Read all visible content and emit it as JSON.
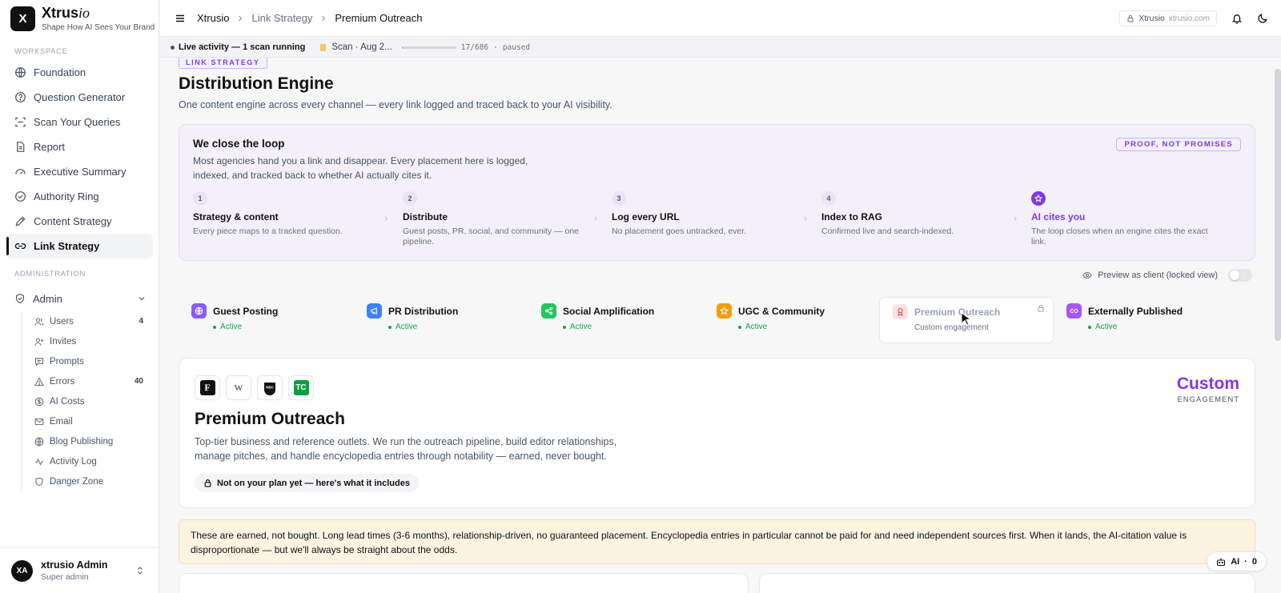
{
  "brand": {
    "name": "Xtrus",
    "name_italic": "io",
    "initial": "X",
    "tagline": "Shape How AI Sees Your Brand"
  },
  "sidebar": {
    "workspace_label": "WORKSPACE",
    "items": [
      {
        "label": "Foundation",
        "icon": "globe-icon"
      },
      {
        "label": "Question Generator",
        "icon": "help-circle-icon"
      },
      {
        "label": "Scan Your Queries",
        "icon": "scan-icon"
      },
      {
        "label": "Report",
        "icon": "document-icon"
      },
      {
        "label": "Executive Summary",
        "icon": "gauge-icon"
      },
      {
        "label": "Authority Ring",
        "icon": "check-circle-icon"
      },
      {
        "label": "Content Strategy",
        "icon": "pen-icon"
      },
      {
        "label": "Link Strategy",
        "icon": "link-icon",
        "active": true
      }
    ],
    "admin_label": "ADMINISTRATION",
    "admin_group": "Admin",
    "admin_items": [
      {
        "label": "Users",
        "count": "4",
        "icon": "users-icon"
      },
      {
        "label": "Invites",
        "icon": "user-plus-icon"
      },
      {
        "label": "Prompts",
        "icon": "message-icon"
      },
      {
        "label": "Errors",
        "count": "40",
        "icon": "warning-icon"
      },
      {
        "label": "AI Costs",
        "icon": "dollar-icon"
      },
      {
        "label": "Email",
        "icon": "mail-icon"
      },
      {
        "label": "Blog Publishing",
        "icon": "globe-icon"
      },
      {
        "label": "Activity Log",
        "icon": "activity-icon"
      },
      {
        "label": "Danger Zone",
        "icon": "shield-icon"
      }
    ],
    "user": {
      "initials": "XA",
      "name": "xtrusio Admin",
      "role": "Super admin"
    }
  },
  "topbar": {
    "breadcrumb": [
      "Xtrusio",
      "Link Strategy",
      "Premium Outreach"
    ],
    "site_label": "Xtrusio",
    "site_domain": "xtrusio.com"
  },
  "activity": {
    "label": "Live activity — 1 scan running",
    "scan_label": "Scan · Aug 2...",
    "progress_fraction": 0.0248,
    "progress_text": "17/686",
    "separator": "·",
    "state": "paused"
  },
  "page": {
    "eyebrow": "LINK STRATEGY",
    "title": "Distribution Engine",
    "subtitle": "One content engine across every channel — every link logged and traced back to your AI visibility."
  },
  "loop": {
    "title": "We close the loop",
    "desc": "Most agencies hand you a link and disappear. Every placement here is logged, indexed, and tracked back to whether AI actually cites it.",
    "badge": "PROOF, NOT PROMISES",
    "steps": [
      {
        "num": "1",
        "title": "Strategy & content",
        "desc": "Every piece maps to a tracked question."
      },
      {
        "num": "2",
        "title": "Distribute",
        "desc": "Guest posts, PR, social, and community — one pipeline."
      },
      {
        "num": "3",
        "title": "Log every URL",
        "desc": "No placement goes untracked, ever."
      },
      {
        "num": "4",
        "title": "Index to RAG",
        "desc": "Confirmed live and search-indexed."
      },
      {
        "num": "★",
        "title": "AI cites you",
        "desc": "The loop closes when an engine cites the exact link."
      }
    ]
  },
  "preview": {
    "label": "Preview as client (locked view)",
    "enabled": false
  },
  "channels": [
    {
      "name": "Guest Posting",
      "status": "Active",
      "color": "#8b5cf6",
      "icon": "globe-icon"
    },
    {
      "name": "PR Distribution",
      "status": "Active",
      "color": "#3b82f6",
      "icon": "megaphone-icon"
    },
    {
      "name": "Social Amplification",
      "status": "Active",
      "color": "#22c55e",
      "icon": "share-icon"
    },
    {
      "name": "UGC & Community",
      "status": "Active",
      "color": "#f59e0b",
      "icon": "star-icon"
    },
    {
      "name": "Premium Outreach",
      "status": "Custom engagement",
      "color": "#fecaca",
      "icon": "award-icon",
      "selected": true,
      "locked": true
    },
    {
      "name": "Externally Published",
      "status": "Active",
      "color": "#a855f7",
      "icon": "link-icon"
    }
  ],
  "detail": {
    "logos": [
      "F",
      "W",
      "NBC",
      "TC"
    ],
    "title": "Premium Outreach",
    "desc": "Top-tier business and reference outlets. We run the outreach pipeline, build editor relationships, manage pitches, and handle encyclopedia entries through notability — earned, never bought.",
    "plan_note": "Not on your plan yet — here's what it includes",
    "price": "Custom",
    "price_sub": "ENGAGEMENT"
  },
  "warning": "These are earned, not bought. Long lead times (3-6 months), relationship-driven, no guaranteed placement. Encyclopedia entries in particular cannot be paid for and need independent sources first. When it lands, the AI-citation value is disproportionate — but we'll always be straight about the odds.",
  "ai_pill": {
    "label": "AI",
    "separator": "·",
    "count": "0"
  }
}
